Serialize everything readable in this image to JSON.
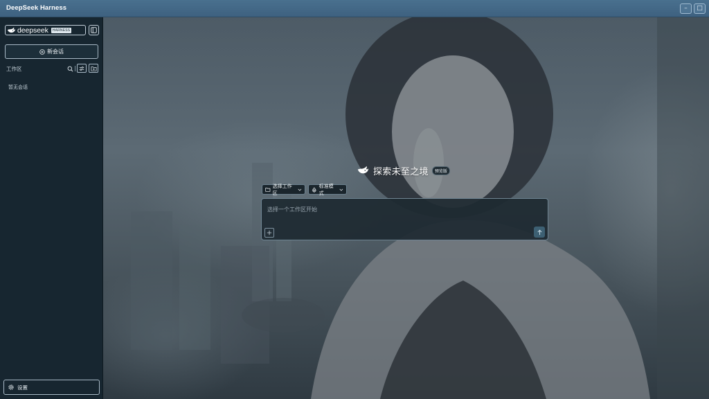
{
  "window": {
    "title": "DeepSeek Harness",
    "minimize_glyph": "–",
    "maximize_glyph": "□"
  },
  "sidebar": {
    "brand_name": "deepseek",
    "brand_tag": "HARNESS",
    "new_chat_label": "新会话",
    "workspace_label": "工作区",
    "empty_sessions": "暂无会话",
    "settings_label": "设置"
  },
  "main": {
    "hero_title": "探索未至之境",
    "hero_badge": "预览版",
    "workspace_chip": "选择工作区",
    "mode_chip": "标准模式",
    "prompt_placeholder": "选择一个工作区开始"
  },
  "icons": {
    "brand": "whale-icon",
    "collapse": "sidebar-toggle-icon",
    "new_chat": "plus-circle-icon",
    "search": "search-icon",
    "filter": "sliders-icon",
    "add_folder": "folder-plus-icon",
    "settings": "gear-icon",
    "folder": "folder-icon",
    "mode": "recycle-icon",
    "chevron": "chevron-down-icon",
    "attach": "plus-icon",
    "send": "arrow-up-icon"
  },
  "colors": {
    "titlebar": "#436786",
    "sidebar": "#172630",
    "accent_send": "#3d6073"
  }
}
